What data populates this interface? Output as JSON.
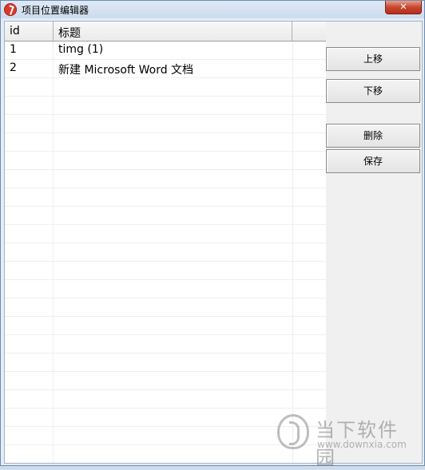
{
  "window": {
    "title": "项目位置编辑器",
    "close_label": "✕"
  },
  "list": {
    "columns": {
      "id": "id",
      "title": "标题"
    },
    "rows": [
      {
        "id": "1",
        "title": "timg (1)"
      },
      {
        "id": "2",
        "title": "新建 Microsoft Word 文档"
      }
    ]
  },
  "buttons": {
    "move_up": "上移",
    "move_down": "下移",
    "delete": "删除",
    "save": "保存"
  },
  "watermark": {
    "text": "当下软件园",
    "url": "www.downxia.com"
  }
}
